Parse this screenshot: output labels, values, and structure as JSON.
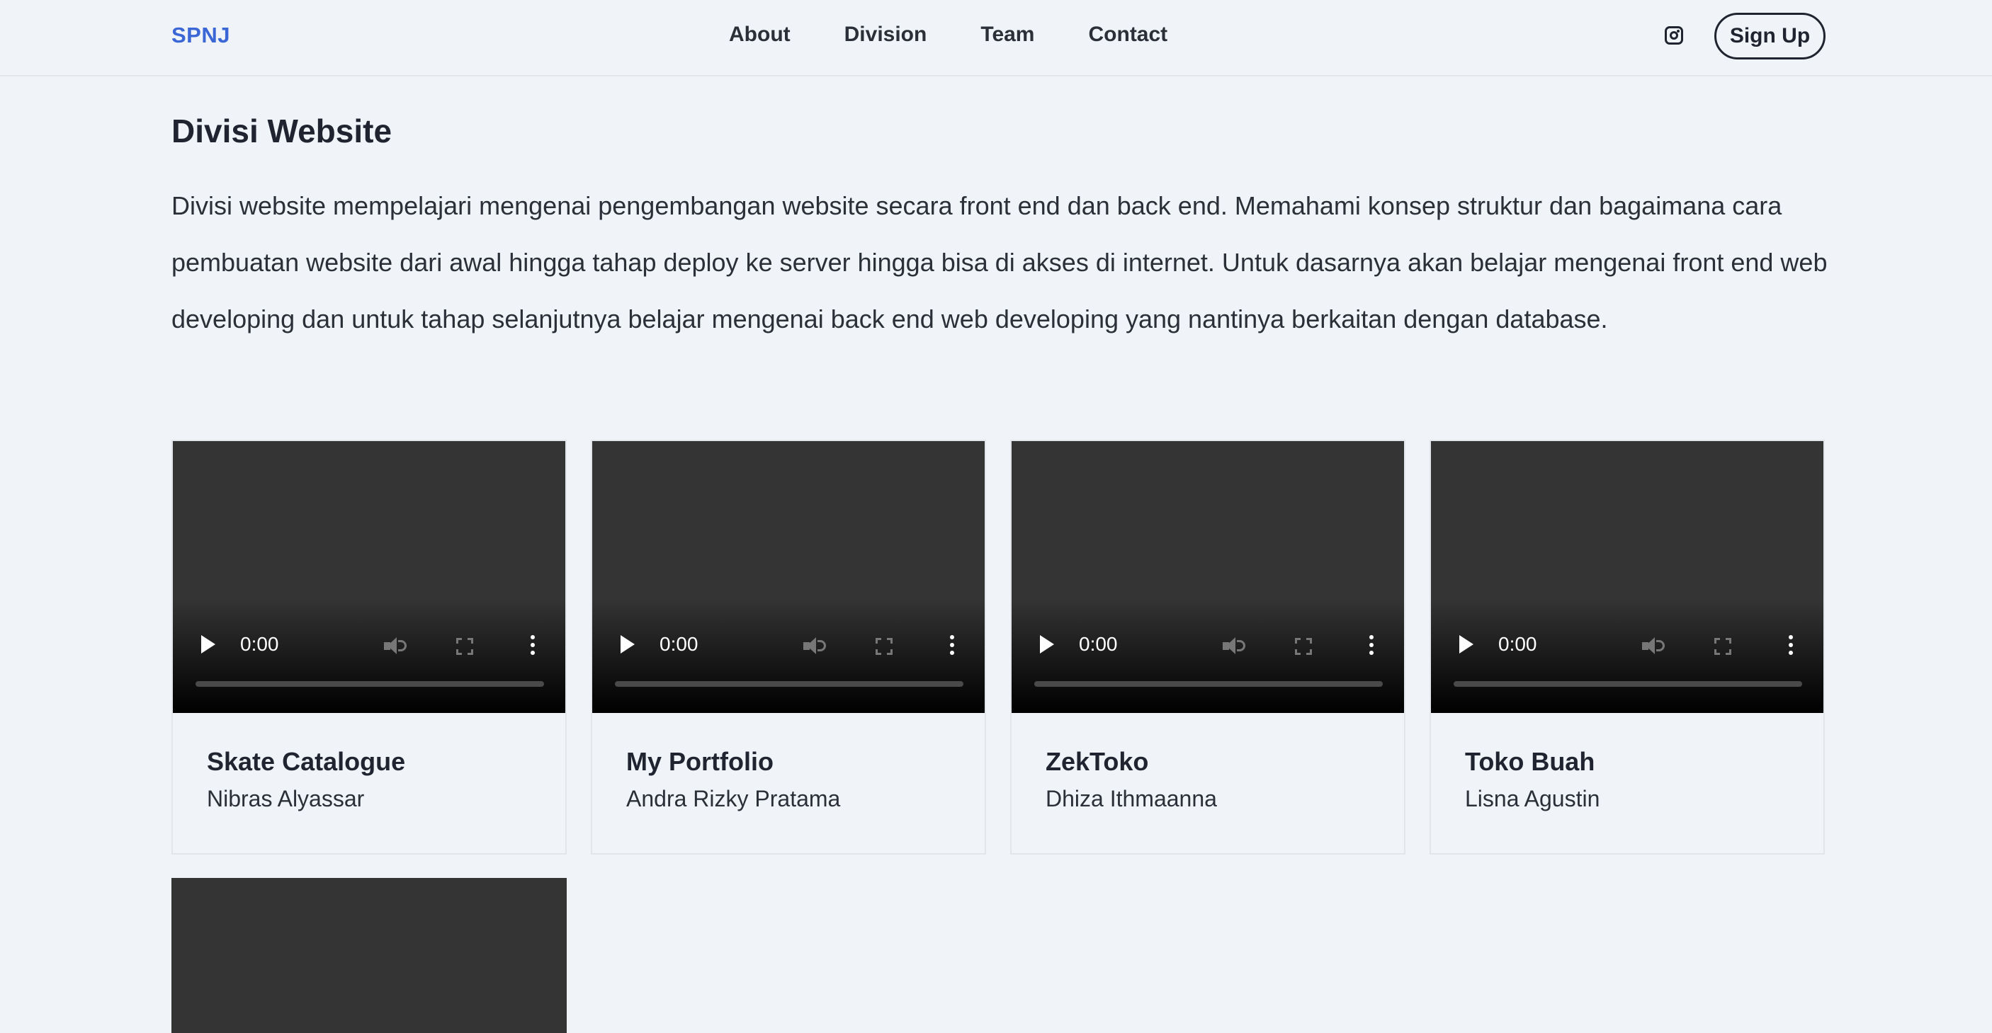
{
  "nav": {
    "brand": "SPNJ",
    "links": [
      "About",
      "Division",
      "Team",
      "Contact"
    ],
    "signup_label": "Sign Up"
  },
  "main": {
    "title": "Divisi Website",
    "description": "Divisi website mempelajari mengenai pengembangan website secara front end dan back end. Memahami konsep struktur dan bagaimana cara pembuatan website dari awal hingga tahap deploy ke server hingga bisa di akses di internet. Untuk dasarnya akan belajar mengenai front end web developing dan untuk tahap selanjutnya belajar mengenai back end web developing yang nantinya berkaitan dengan database."
  },
  "projects": [
    {
      "title": "Skate Catalogue",
      "author": "Nibras Alyassar",
      "time": "0:00"
    },
    {
      "title": "My Portfolio",
      "author": "Andra Rizky Pratama",
      "time": "0:00"
    },
    {
      "title": "ZekToko",
      "author": "Dhiza Ithmaanna",
      "time": "0:00"
    },
    {
      "title": "Toko Buah",
      "author": "Lisna Agustin",
      "time": "0:00"
    }
  ],
  "colors": {
    "background": "#f0f4f8",
    "brand": "#3a66d6",
    "text": "#1f2430",
    "video_bg": "#343434"
  },
  "icons": {
    "social": "instagram-icon",
    "video_controls": [
      "play-icon",
      "mute-icon",
      "fullscreen-icon",
      "more-options-icon"
    ]
  }
}
